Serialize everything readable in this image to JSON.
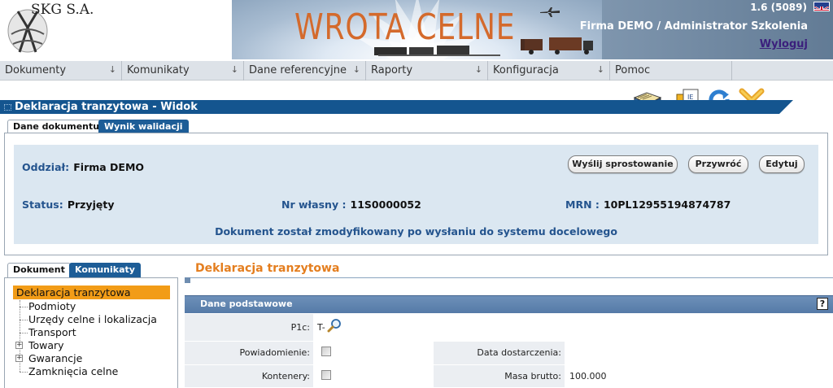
{
  "header": {
    "logo_text": "SKG S.A.",
    "app_title": "WROTA CELNE",
    "version": "1.6 (5089)",
    "company_user": "Firma DEMO / Administrator Szkolenia",
    "logout_label": "Wyloguj"
  },
  "menu": {
    "items": [
      {
        "label": "Dokumenty"
      },
      {
        "label": "Komunikaty"
      },
      {
        "label": "Dane referencyjne"
      },
      {
        "label": "Raporty"
      },
      {
        "label": "Konfiguracja"
      },
      {
        "label": "Pomoc"
      }
    ]
  },
  "page": {
    "title": "Deklaracja tranzytowa  -  Widok"
  },
  "toolbar": {
    "icons": [
      "book-icon",
      "export-document-icon",
      "refresh-icon",
      "close-icon"
    ]
  },
  "tabs": {
    "main": [
      {
        "label": "Dane dokumentu",
        "active": true
      },
      {
        "label": "Wynik walidacji",
        "active": false
      }
    ],
    "left": [
      {
        "label": "Dokument",
        "active": true
      },
      {
        "label": "Komunikaty",
        "active": false
      }
    ]
  },
  "document": {
    "branch_label": "Oddział:",
    "branch_value": "Firma DEMO",
    "status_label": "Status:",
    "status_value": "Przyjęty",
    "own_no_label": "Nr własny :",
    "own_no_value": "11S0000052",
    "mrn_label": "MRN :",
    "mrn_value": "10PL12955194874787",
    "note": "Dokument został zmodyfikowany po wysłaniu do systemu docelowego",
    "buttons": {
      "send_correction": "Wyślij sprostowanie",
      "restore": "Przywróć",
      "edit": "Edytuj"
    }
  },
  "tree": {
    "root": "Deklaracja tranzytowa",
    "items": [
      {
        "label": "Podmioty",
        "expandable": false
      },
      {
        "label": "Urzędy celne i lokalizacja",
        "expandable": false
      },
      {
        "label": "Transport",
        "expandable": false
      },
      {
        "label": "Towary",
        "expandable": true
      },
      {
        "label": "Gwarancje",
        "expandable": true
      },
      {
        "label": "Zamknięcia celne",
        "expandable": false
      }
    ]
  },
  "form": {
    "title": "Deklaracja tranzytowa",
    "section": "Dane podstawowe",
    "help_label": "?",
    "fields": {
      "p1c_label": "P1c:",
      "p1c_value": "T-",
      "notification_label": "Powiadomienie:",
      "notification_checked": false,
      "delivery_date_label": "Data dostarczenia:",
      "delivery_date_value": "",
      "containers_label": "Kontenery:",
      "containers_checked": false,
      "gross_mass_label": "Masa brutto:",
      "gross_mass_value": "100.000"
    }
  },
  "colors": {
    "accent_orange": "#e47e1f",
    "title_bar_blue": "#14558f",
    "label_blue": "#24548e",
    "tree_selection": "#f29c17"
  }
}
